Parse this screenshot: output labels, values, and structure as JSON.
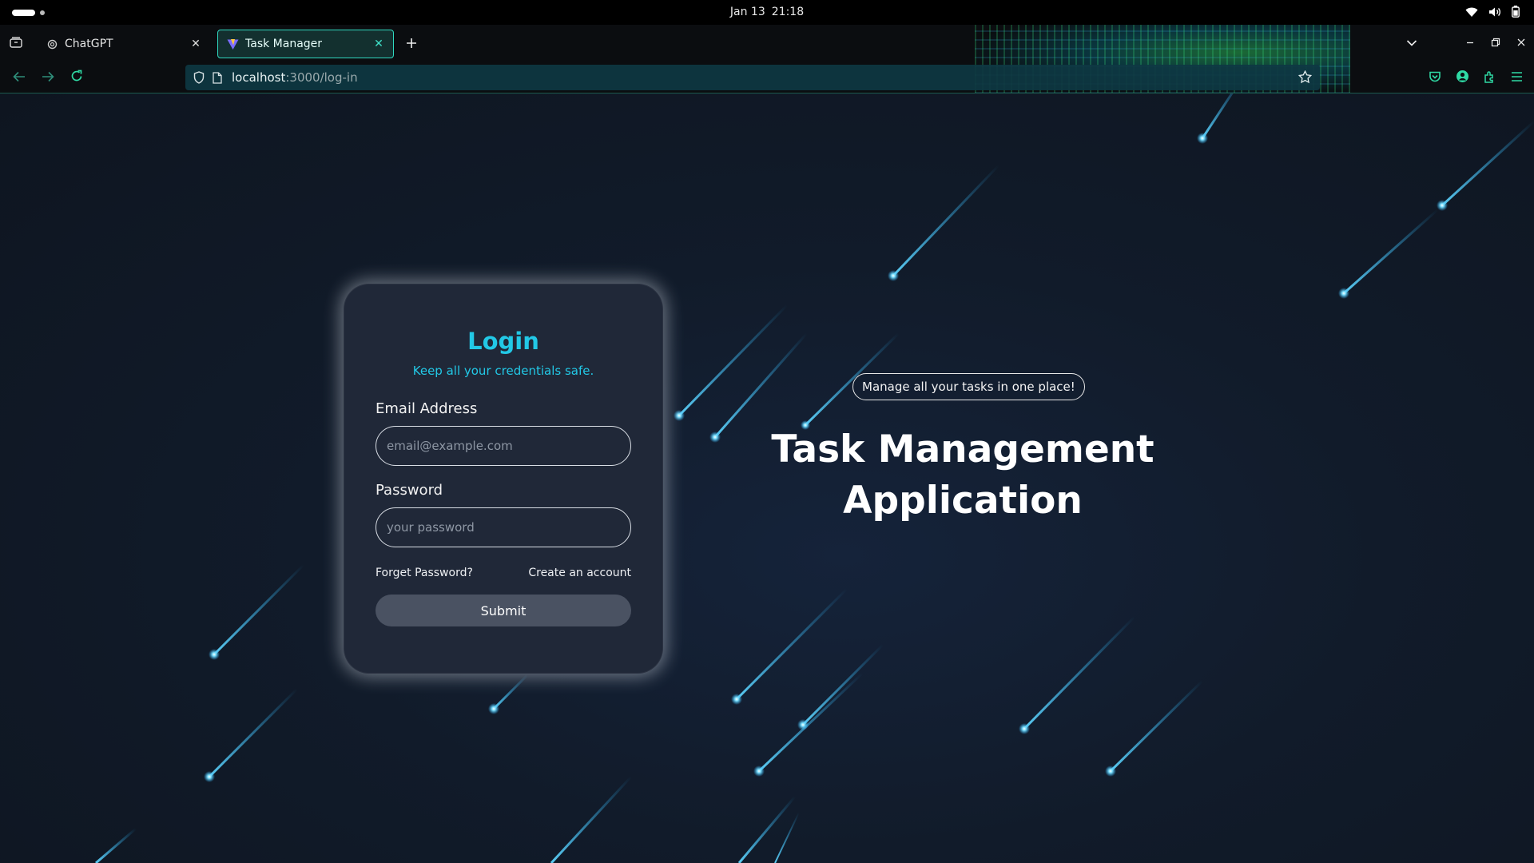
{
  "os_bar": {
    "date": "Jan 13",
    "time": "21:18"
  },
  "browser": {
    "tabs": [
      {
        "title": "ChatGPT",
        "favicon": "openai-icon",
        "active": false
      },
      {
        "title": "Task Manager",
        "favicon": "vite-icon",
        "active": true
      }
    ],
    "url": {
      "host": "localhost",
      "path": ":3000/log-in"
    }
  },
  "login": {
    "title": "Login",
    "subtitle": "Keep all your credentials safe.",
    "email_label": "Email Address",
    "email_placeholder": "email@example.com",
    "email_value": "",
    "password_label": "Password",
    "password_placeholder": "your password",
    "password_value": "",
    "forget_link": "Forget Password?",
    "create_link": "Create an account",
    "submit_label": "Submit"
  },
  "hero": {
    "tagline": "Manage all your tasks in one place!",
    "title": "Task Management Application"
  },
  "colors": {
    "accent": "#22c8e6",
    "tab_active_border": "#2fd9c0",
    "card_bg": "#202838",
    "submit_bg": "#4a5262",
    "page_bg": "#111b2a"
  }
}
